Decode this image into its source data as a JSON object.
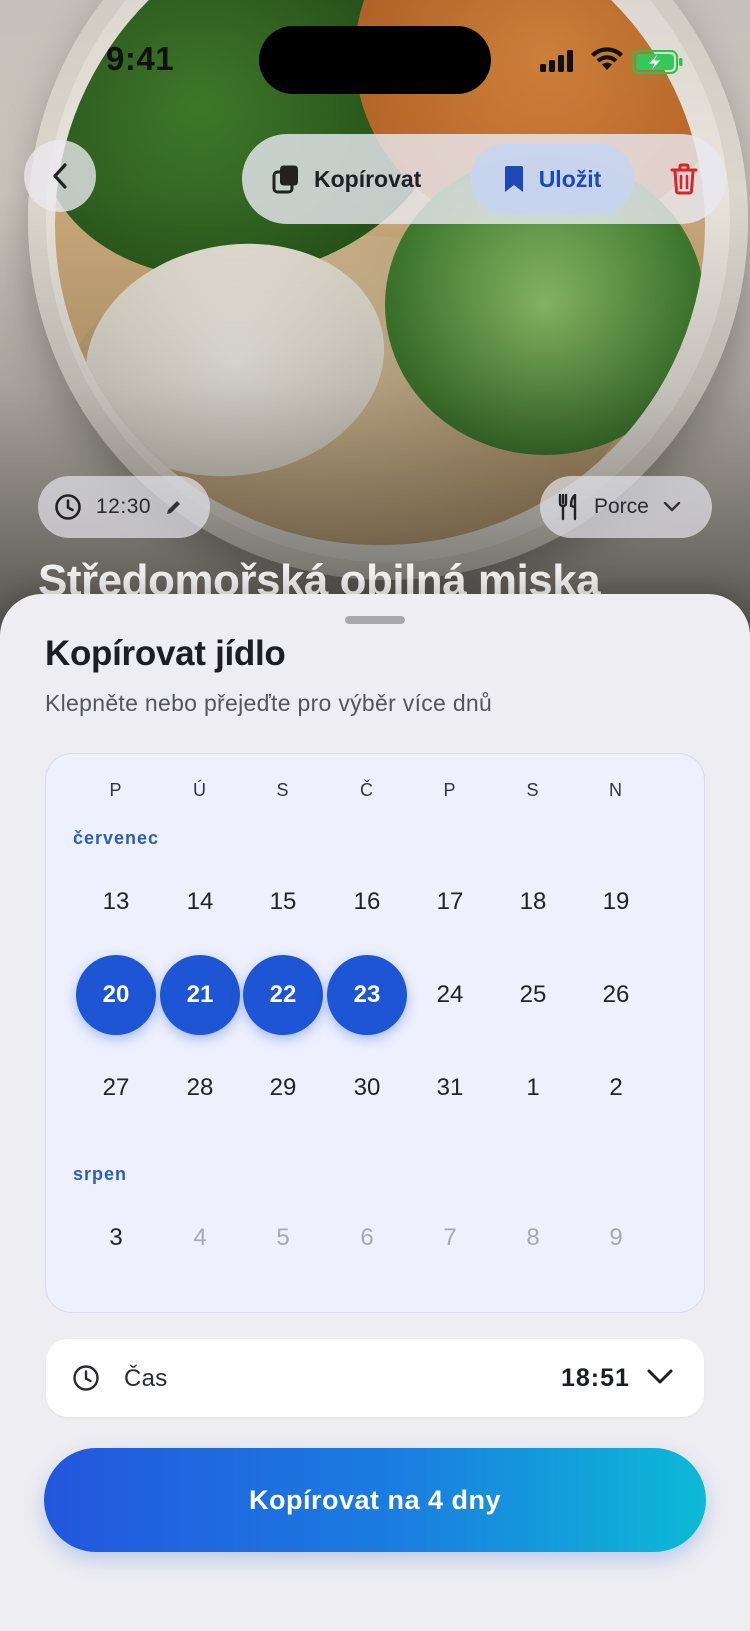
{
  "status_bar": {
    "time": "9:41"
  },
  "header": {
    "copy_label": "Kopírovat",
    "save_label": "Uložit"
  },
  "meal": {
    "time": "12:30",
    "portion_label": "Porce",
    "title": "Středomořská obilná miska"
  },
  "sheet": {
    "title": "Kopírovat jídlo",
    "subtitle": "Klepněte nebo přejeďte pro výběr více dnů"
  },
  "calendar": {
    "weekdays": [
      "P",
      "Ú",
      "S",
      "Č",
      "P",
      "S",
      "N"
    ],
    "months": [
      {
        "name": "červenec",
        "weeks": [
          [
            "13",
            "14",
            "15",
            "16",
            "17",
            "18",
            "19"
          ],
          [
            "20",
            "21",
            "22",
            "23",
            "24",
            "25",
            "26"
          ],
          [
            "27",
            "28",
            "29",
            "30",
            "31",
            "1",
            "2"
          ]
        ]
      },
      {
        "name": "srpen",
        "weeks": [
          [
            "3",
            "4",
            "5",
            "6",
            "7",
            "8",
            "9"
          ]
        ]
      }
    ],
    "selected_days": [
      "20",
      "21",
      "22",
      "23"
    ],
    "disabled_days_srpen": [
      "4",
      "5",
      "6",
      "7",
      "8",
      "9"
    ]
  },
  "time_field": {
    "label": "Čas",
    "value": "18:51"
  },
  "cta_label": "Kopírovat na 4 dny",
  "colors": {
    "accent": "#1e55d4",
    "cta_gradient_start": "#2356de",
    "cta_gradient_end": "#0cbad6",
    "delete": "#d6262b",
    "month_label": "#2a60b8"
  }
}
